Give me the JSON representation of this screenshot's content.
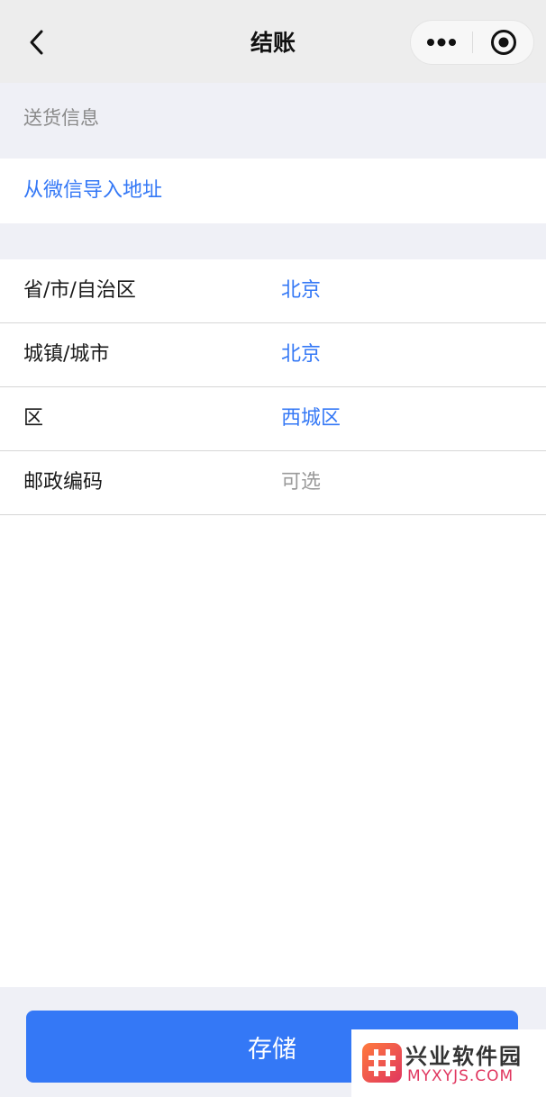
{
  "header": {
    "title": "结账"
  },
  "section": {
    "title": "送货信息",
    "import_label": "从微信导入地址"
  },
  "form": {
    "rows": [
      {
        "label": "省/市/自治区",
        "value": "北京",
        "is_placeholder": false
      },
      {
        "label": "城镇/城市",
        "value": "北京",
        "is_placeholder": false
      },
      {
        "label": "区",
        "value": "西城区",
        "is_placeholder": false
      },
      {
        "label": "邮政编码",
        "value": "可选",
        "is_placeholder": true
      }
    ]
  },
  "footer": {
    "save_label": "存储"
  },
  "watermark": {
    "title": "兴业软件园",
    "url": "MYXYJS.COM"
  },
  "colors": {
    "accent": "#3478f6",
    "navbar_bg": "#ededed",
    "section_bg": "#eff0f6",
    "placeholder": "#9a9a9a",
    "watermark_accent": "#e0365f"
  },
  "icons": {
    "back": "chevron-left-icon",
    "more": "more-dots-icon",
    "close": "target-close-icon",
    "logo": "hash-logo-icon"
  }
}
